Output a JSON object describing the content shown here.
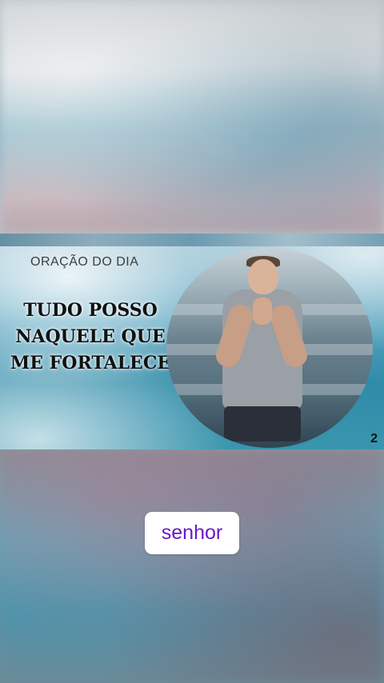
{
  "banner": {
    "subtitle": "ORAÇÃO  DO DIA",
    "headline": "TUDO POSSO NAQUELE QUE ME FORTALECE",
    "page_number": "2"
  },
  "caption": {
    "word": "senhor",
    "color": "#6a19c7"
  }
}
